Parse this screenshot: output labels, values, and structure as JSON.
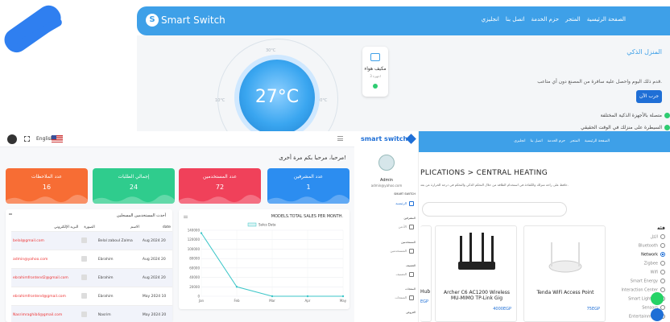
{
  "top_site": {
    "brand": "Smart Switch",
    "brand_initial": "S",
    "nav_links": [
      "الصفحة الرئيسية",
      "المتجر",
      "حزم الخدمة",
      "اتصل بنا",
      "انجليزي"
    ],
    "ac_card": {
      "title": "مكيف هواء",
      "subtitle": "3 اجهزة"
    },
    "temperature": "27°C",
    "dial_ticks": [
      "20°C",
      "30°C",
      "10°C"
    ],
    "hero_title": "المنزل الذكي",
    "hero_desc": "قدم ذلك اليوم واحصل عليه سافرة من المصنع دون أي متاعب.",
    "cta": "جرب الآن",
    "features": [
      "متصلة بالأجهزة الذكية المختلفة",
      "السيطرة على منزلك في الوقت الحقيقي"
    ]
  },
  "admin": {
    "language": "English",
    "welcome": "مرحبا، مرحبا بكم مرة أخرى!",
    "stats": [
      {
        "label": "عدد المشرفين",
        "value": "1",
        "color": "#2c8df0"
      },
      {
        "label": "عدد المستخدمين",
        "value": "72",
        "color": "#f0415a"
      },
      {
        "label": "إجمالي الطلبات",
        "value": "24",
        "color": "#2fcc8d"
      },
      {
        "label": "عدد الملاحظات",
        "value": "16",
        "color": "#f76d34"
      }
    ],
    "sales_panel": {
      "title": "MODELS.TOTAL SALES PER MONTH."
    },
    "users_panel": {
      "title": "أحدث المستخدمين المسجلين",
      "headers": [
        "date",
        "الاسم",
        "الصورة",
        "البريد الإلكتروني"
      ],
      "rows": [
        {
          "date": "Aug 2024 20",
          "name": "Belal zaboul Zalma",
          "email": "belal@gmail.com"
        },
        {
          "date": "Aug 2024 20",
          "name": "Ebrahim",
          "email": "admin@yahoo.com"
        },
        {
          "date": "Aug 2024 20",
          "name": "Ebrahim",
          "email": "ebrahimfrontend2@gmail.com"
        },
        {
          "date": "May 2024 10",
          "name": "Ebrahim",
          "email": "ebrahimfrontend@gmail.com"
        },
        {
          "date": "May 2024 20",
          "name": "Nasrim",
          "email": "Nasrimraghib4@gmail.com"
        }
      ]
    }
  },
  "chart_data": {
    "type": "line",
    "title": "MODELS.TOTAL SALES PER MONTH.",
    "categories": [
      "Jan",
      "Feb",
      "Mar",
      "Apr",
      "May"
    ],
    "series": [
      {
        "name": "Sales Data",
        "values": [
          134000,
          20000,
          0,
          0,
          0
        ]
      }
    ],
    "ylim": [
      0,
      140000
    ],
    "yticks": [
      0,
      20000,
      40000,
      60000,
      80000,
      100000,
      120000,
      140000
    ],
    "legend": "top-center",
    "grid": true,
    "color": "#3cc6c8"
  },
  "shop": {
    "brand": "smart switch",
    "admin_name": "Admin",
    "admin_email": "admin@yahoo.com",
    "sidebar_sections": [
      "SMART SWITCH",
      "المشرفين",
      "المستخدمين",
      "التصنيف",
      "المنتجات",
      "العروض"
    ],
    "sidebar_items": [
      "الرئيسية",
      "الأدمن",
      "المستخدمين",
      "التصنيف",
      "المنتجات"
    ],
    "nav_links": [
      "الصفحة الرئيسية",
      "المتجر",
      "حزم الخدمة",
      "اتصل بنا",
      "انجليزي"
    ],
    "breadcrumb": "PLICATIONS > CENTRAL HEATING",
    "description": "حافظ على راحة منزلك والكفاءة في استخدام الطاقة من خلال التحكم الذكي والتحكم في درجة الحرارة عن بعد.",
    "products": [
      {
        "name": "Hub",
        "price": "EGP"
      },
      {
        "name": "Archer C6 AC1200 Wireless MU-MIMO TP-Link Gig",
        "price": "4000EGP"
      },
      {
        "name": "Tenda WiFi Access Point",
        "price": "75EGP"
      }
    ],
    "filters_title": "فئة",
    "filters": [
      {
        "label": "الكل",
        "on": false
      },
      {
        "label": "Bluetooth",
        "on": false
      },
      {
        "label": "Network",
        "on": true
      },
      {
        "label": "Zigbee",
        "on": false
      },
      {
        "label": "Wifi",
        "on": false
      },
      {
        "label": "Smart Energy",
        "on": false
      },
      {
        "label": "Interaction Center",
        "on": false
      },
      {
        "label": "Smart Lighting",
        "on": false
      },
      {
        "label": "Sensors",
        "on": false
      },
      {
        "label": "Entertainment",
        "on": false
      }
    ]
  }
}
